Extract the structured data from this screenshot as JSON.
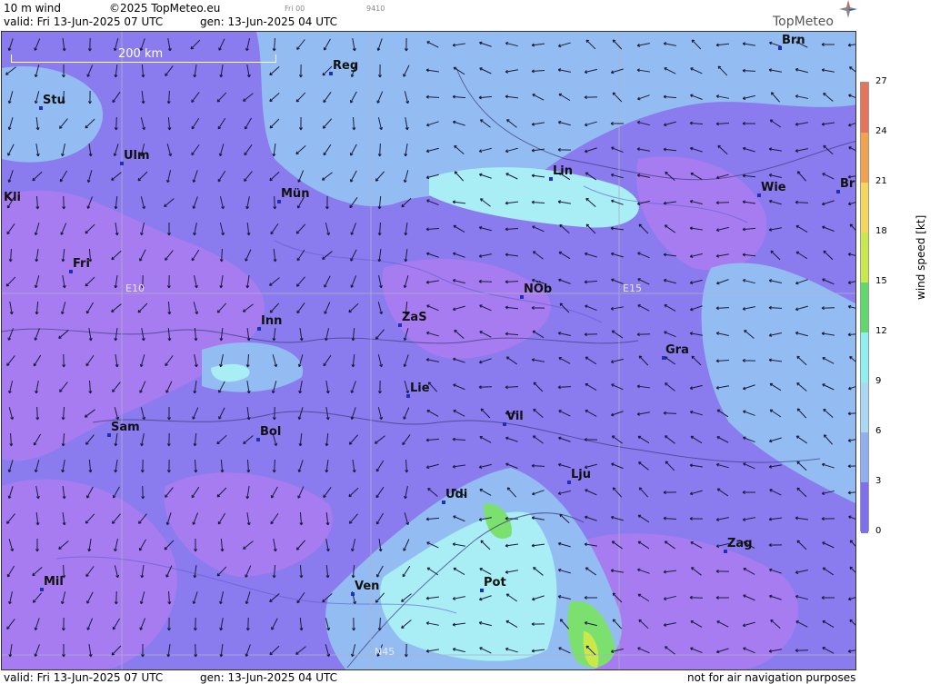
{
  "header": {
    "title": "10 m wind",
    "copyright": "©2025 TopMeteo.eu",
    "run": "Fri 00",
    "code": "9410",
    "valid": "valid:  Fri  13-Jun-2025  07 UTC",
    "gen": "gen: 13-Jun-2025 04 UTC"
  },
  "footer": {
    "valid": "valid:  Fri  13-Jun-2025  07 UTC",
    "gen": "gen: 13-Jun-2025 04 UTC",
    "disclaimer": "not for air navigation purposes"
  },
  "logo": {
    "text": "TopMeteo",
    "icon": "compass-star-icon"
  },
  "scale": {
    "label": "200 km"
  },
  "grid_labels": {
    "e10": "E10",
    "e15": "E15",
    "n45": "N45"
  },
  "cities": [
    "Brn",
    "Reg",
    "Stu",
    "Ulm",
    "Lin",
    "Wie",
    "Br",
    "Kli",
    "Mün",
    "Fri",
    "NÖb",
    "E15",
    "Inn",
    "ZaS",
    "Gra",
    "Lie",
    "Vil",
    "Sam",
    "Bol",
    "Lju",
    "Udi",
    "Zag",
    "Mil",
    "Ven",
    "Pot"
  ],
  "city_labels": {
    "brn": "Brn",
    "reg": "Reg",
    "stu": "Stu",
    "ulm": "Ulm",
    "lin": "Lin",
    "wie": "Wie",
    "br": "Br",
    "kli": "Kli",
    "mun": "Mün",
    "fri": "Fri",
    "nob": "NÖb",
    "inn": "Inn",
    "zas": "ZaS",
    "gra": "Gra",
    "lie": "Lie",
    "vil": "Vil",
    "sam": "Sam",
    "bol": "Bol",
    "lju": "Lju",
    "udi": "Udi",
    "zag": "Zag",
    "mil": "Mil",
    "ven": "Ven",
    "pot": "Pot"
  },
  "legend": {
    "unit_label": "wind speed  [kt]",
    "ticks": [
      "27",
      "24",
      "21",
      "18",
      "15",
      "12",
      "9",
      "6",
      "3",
      "0"
    ],
    "colors": [
      "#e8735a",
      "#f2a24a",
      "#f5d85a",
      "#c9e84a",
      "#5fd96a",
      "#8ef0f0",
      "#a9d8f5",
      "#8fb0f0",
      "#7e6ff0",
      "#b67cf0"
    ]
  },
  "colors": {
    "low": "#9b77ee",
    "mid": "#8878ea",
    "light": "#93bdf2",
    "cyan": "#a8eef4",
    "green": "#7ce06e"
  }
}
